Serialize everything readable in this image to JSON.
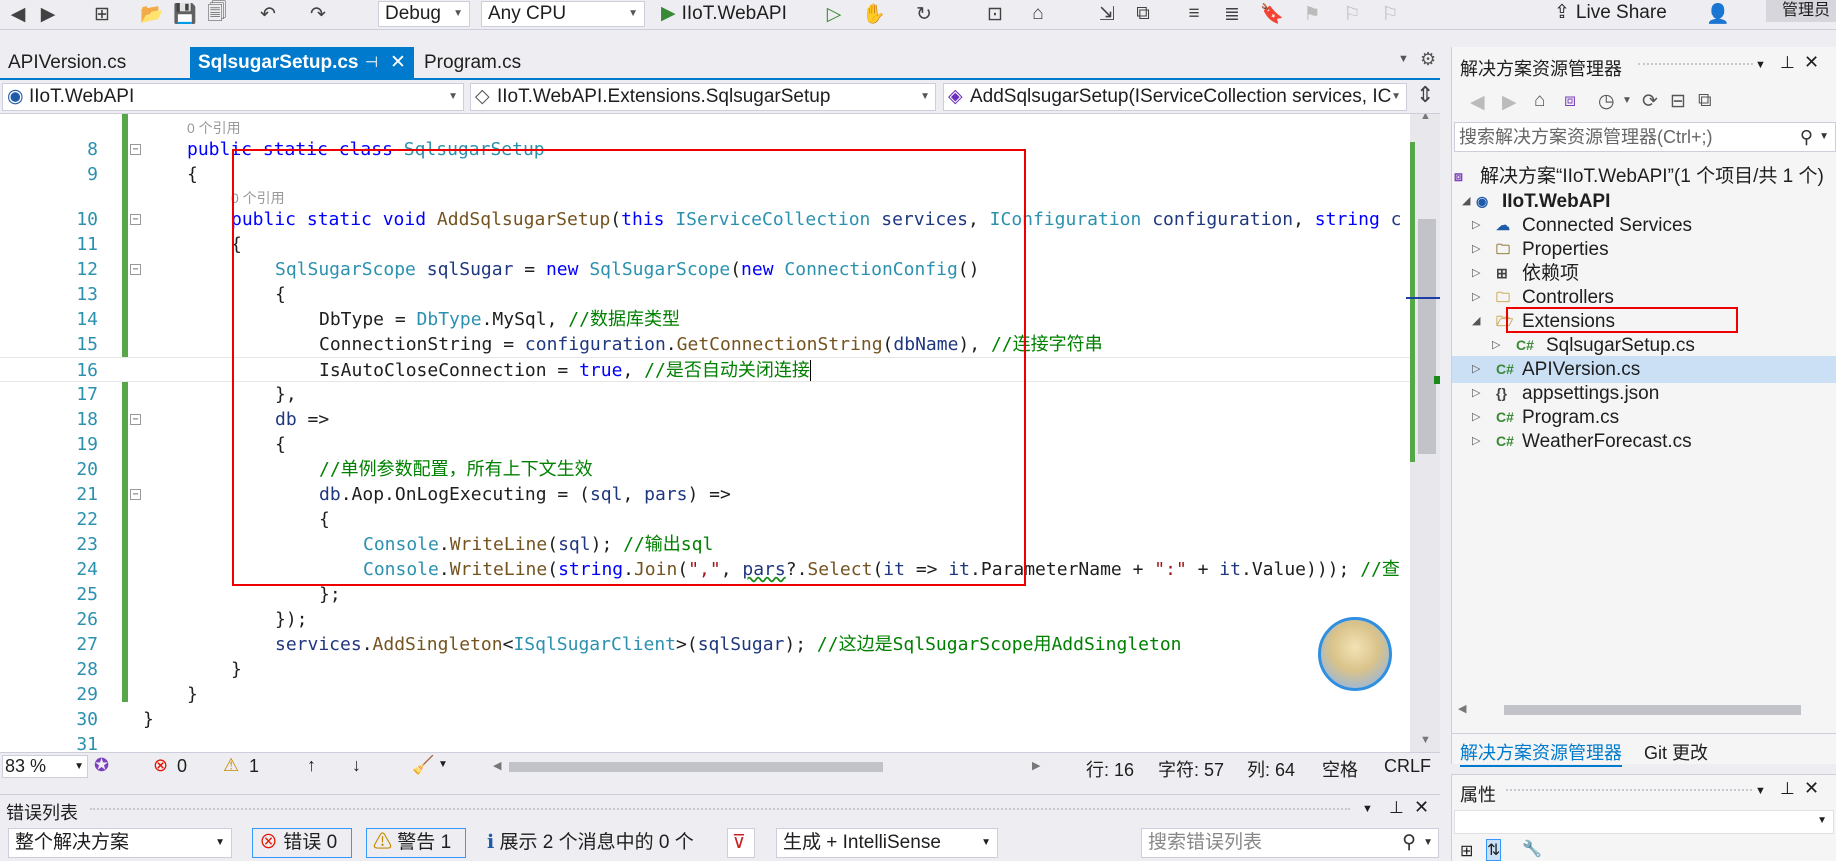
{
  "toolbar": {
    "config": "Debug",
    "platform": "Any CPU",
    "start_target": "IIoT.WebAPI",
    "live_share": "Live Share",
    "admin": "管理员"
  },
  "tabs": [
    {
      "label": "APIVersion.cs",
      "active": false
    },
    {
      "label": "SqlsugarSetup.cs",
      "active": true
    },
    {
      "label": "Program.cs",
      "active": false
    }
  ],
  "nav": {
    "project": "IIoT.WebAPI",
    "class": "IIoT.WebAPI.Extensions.SqlsugarSetup",
    "member": "AddSqlsugarSetup(IServiceCollection services, IC"
  },
  "code": {
    "ref_label_1": "0 个引用",
    "ref_label_2": "0 个引用",
    "lines": [
      {
        "n": "8",
        "text": "public static class SqlsugarSetup"
      },
      {
        "n": "9",
        "text": "{"
      },
      {
        "n": "10",
        "text": "public static void AddSqlsugarSetup(this IServiceCollection services, IConfiguration configuration, string c"
      },
      {
        "n": "11",
        "text": "{"
      },
      {
        "n": "12",
        "text": "SqlSugarScope sqlSugar = new SqlSugarScope(new ConnectionConfig()"
      },
      {
        "n": "13",
        "text": "{"
      },
      {
        "n": "14",
        "text": "DbType = DbType.MySql, //数据库类型"
      },
      {
        "n": "15",
        "text": "ConnectionString = configuration.GetConnectionString(dbName), //连接字符串"
      },
      {
        "n": "16",
        "text": "IsAutoCloseConnection = true, //是否自动关闭连接"
      },
      {
        "n": "17",
        "text": "},"
      },
      {
        "n": "18",
        "text": "db =>"
      },
      {
        "n": "19",
        "text": "{"
      },
      {
        "n": "20",
        "text": "//单例参数配置，所有上下文生效"
      },
      {
        "n": "21",
        "text": "db.Aop.OnLogExecuting = (sql, pars) =>"
      },
      {
        "n": "22",
        "text": "{"
      },
      {
        "n": "23",
        "text": "Console.WriteLine(sql); //输出sql"
      },
      {
        "n": "24",
        "text": "Console.WriteLine(string.Join(\",\", pars?.Select(it => it.ParameterName + \":\" + it.Value))); //查"
      },
      {
        "n": "25",
        "text": "};"
      },
      {
        "n": "26",
        "text": "});"
      },
      {
        "n": "27",
        "text": "services.AddSingleton<ISqlSugarClient>(sqlSugar); //这边是SqlSugarScope用AddSingleton"
      },
      {
        "n": "28",
        "text": "}"
      },
      {
        "n": "29",
        "text": "}"
      },
      {
        "n": "30",
        "text": "}"
      },
      {
        "n": "31",
        "text": ""
      }
    ]
  },
  "status": {
    "zoom": "83 %",
    "errors": "0",
    "warnings": "1",
    "row": "行: 16",
    "char": "字符: 57",
    "col": "列: 64",
    "space": "空格",
    "eol": "CRLF"
  },
  "error_list": {
    "title": "错误列表",
    "scope": "整个解决方案",
    "errors_btn": "错误 0",
    "warnings_btn": "警告 1",
    "messages_btn": "展示 2 个消息中的 0 个",
    "build": "生成 + IntelliSense",
    "search_placeholder": "搜索错误列表"
  },
  "solution_explorer": {
    "title": "解决方案资源管理器",
    "search_placeholder": "搜索解决方案资源管理器(Ctrl+;)",
    "solution": "解决方案“IIoT.WebAPI”(1 个项目/共 1 个)",
    "project": "IIoT.WebAPI",
    "items": [
      {
        "label": "Connected Services",
        "icon": "connected-services-icon"
      },
      {
        "label": "Properties",
        "icon": "wrench-folder-icon"
      },
      {
        "label": "依赖项",
        "icon": "dependencies-icon"
      },
      {
        "label": "Controllers",
        "icon": "folder-icon"
      },
      {
        "label": "Extensions",
        "icon": "folder-open-icon"
      },
      {
        "label": "SqlsugarSetup.cs",
        "icon": "csharp-file-icon"
      },
      {
        "label": "APIVersion.cs",
        "icon": "csharp-file-icon"
      },
      {
        "label": "appsettings.json",
        "icon": "json-file-icon"
      },
      {
        "label": "Program.cs",
        "icon": "csharp-file-icon"
      },
      {
        "label": "WeatherForecast.cs",
        "icon": "csharp-file-icon"
      }
    ],
    "bottom_tab_1": "解决方案资源管理器",
    "bottom_tab_2": "Git 更改"
  },
  "properties": {
    "title": "属性"
  },
  "colors": {
    "accent": "#007acc",
    "highlight_border": "#e00000"
  }
}
